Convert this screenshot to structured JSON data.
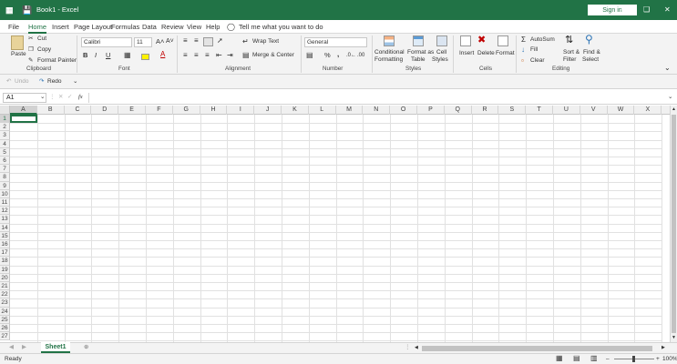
{
  "title_bar": {
    "app_title": "Book1 - Excel",
    "sign_in_label": "Sign in"
  },
  "menu": {
    "items": [
      "File",
      "Home",
      "Insert",
      "Page Layout",
      "Formulas",
      "Data",
      "Review",
      "View",
      "Help"
    ],
    "active": "Home",
    "tell_me": "Tell me what you want to do"
  },
  "ribbon": {
    "clipboard": {
      "paste": "Paste",
      "cut": "Cut",
      "copy": "Copy",
      "format_painter": "Format Painter",
      "label": "Clipboard"
    },
    "font": {
      "font_name": "Calibri",
      "font_size": "11",
      "bold": "B",
      "italic": "I",
      "underline": "U",
      "label": "Font"
    },
    "alignment": {
      "wrap_text": "Wrap Text",
      "merge_center": "Merge & Center",
      "label": "Alignment"
    },
    "number": {
      "format": "General",
      "percent": "%",
      "comma": ",",
      "label": "Number"
    },
    "styles": {
      "conditional_1": "Conditional",
      "conditional_2": "Formatting",
      "format_table_1": "Format as",
      "format_table_2": "Table",
      "cell_styles_1": "Cell",
      "cell_styles_2": "Styles",
      "label": "Styles"
    },
    "cells": {
      "insert": "Insert",
      "delete": "Delete",
      "format": "Format",
      "label": "Cells"
    },
    "editing": {
      "autosum": "AutoSum",
      "fill": "Fill",
      "clear": "Clear",
      "sort_1": "Sort &",
      "sort_2": "Filter",
      "find_1": "Find &",
      "find_2": "Select",
      "label": "Editing"
    }
  },
  "quick_access": {
    "undo": "Undo",
    "redo": "Redo"
  },
  "formula_bar": {
    "name_box": "A1",
    "fx": "fx",
    "value": ""
  },
  "grid": {
    "columns": [
      "A",
      "B",
      "C",
      "D",
      "E",
      "F",
      "G",
      "H",
      "I",
      "J",
      "K",
      "L",
      "M",
      "N",
      "O",
      "P",
      "Q",
      "R",
      "S",
      "T",
      "U",
      "V",
      "W",
      "X"
    ],
    "rows": [
      "1",
      "2",
      "3",
      "4",
      "5",
      "6",
      "7",
      "8",
      "9",
      "10",
      "11",
      "12",
      "13",
      "14",
      "15",
      "16",
      "17",
      "18",
      "19",
      "20",
      "21",
      "22",
      "23",
      "24",
      "25",
      "26",
      "27"
    ],
    "selected_cell": "A1"
  },
  "sheets": {
    "tabs": [
      "Sheet1"
    ],
    "active": "Sheet1"
  },
  "status": {
    "mode": "Ready",
    "zoom": "100%"
  },
  "colors": {
    "brand": "#217346",
    "header_bg": "#f0f0f0",
    "gridline": "#e1e1e1"
  }
}
